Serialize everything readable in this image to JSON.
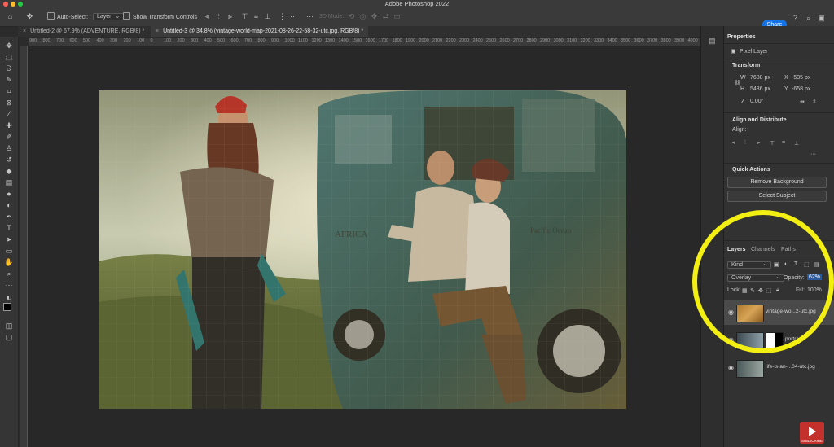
{
  "app": {
    "title": "Adobe Photoshop 2022"
  },
  "options_bar": {
    "auto_select_label": "Auto-Select:",
    "auto_select_value": "Layer",
    "show_transform_label": "Show Transform Controls",
    "mode_3d_label": "3D Mode:",
    "share_label": "Share"
  },
  "tabs": [
    {
      "label": "Untitled-2 @ 67.9% (ADVENTURE, RGB/8) *",
      "active": false
    },
    {
      "label": "Untitled-3 @ 34.8% (vintage-world-map-2021-08-26-22-58-32-utc.jpg, RGB/8) *",
      "active": true
    }
  ],
  "ruler_ticks": [
    "900",
    "800",
    "700",
    "600",
    "500",
    "400",
    "300",
    "200",
    "100",
    "0",
    "100",
    "200",
    "300",
    "400",
    "500",
    "600",
    "700",
    "800",
    "900",
    "1000",
    "1100",
    "1200",
    "1300",
    "1400",
    "1500",
    "1600",
    "1700",
    "1800",
    "1900",
    "2000",
    "2100",
    "2200",
    "2300",
    "2400",
    "2500",
    "2600",
    "2700",
    "2800",
    "2900",
    "3000",
    "3100",
    "3200",
    "3300",
    "3400",
    "3500",
    "3600",
    "3700",
    "3800",
    "3900",
    "4000"
  ],
  "canvas": {
    "map_labels": [
      "AFRICA",
      "Pacific Ocean"
    ]
  },
  "properties": {
    "tab_label": "Properties",
    "layer_type": "Pixel Layer",
    "transform": {
      "title": "Transform",
      "w_label": "W",
      "w_value": "7688 px",
      "x_label": "X",
      "x_value": "-535 px",
      "h_label": "H",
      "h_value": "5436 px",
      "y_label": "Y",
      "y_value": "-658 px",
      "angle_value": "0.00°"
    },
    "align": {
      "title": "Align and Distribute",
      "align_label": "Align:"
    },
    "quick_actions": {
      "title": "Quick Actions",
      "remove_bg": "Remove Background",
      "select_subject": "Select Subject"
    }
  },
  "layers_panel": {
    "tabs": [
      "Layers",
      "Channels",
      "Paths"
    ],
    "kind_label": "Kind",
    "blend_mode": "Overlay",
    "opacity_label": "Opacity:",
    "opacity_value": "62%",
    "lock_label": "Lock:",
    "fill_label": "Fill:",
    "fill_value": "100%",
    "layers": [
      {
        "name": "vintage-wo...2-utc.jpg",
        "selected": true
      },
      {
        "name": "portra",
        "selected": false
      },
      {
        "name": "life-is-an-...04-utc.jpg",
        "selected": false
      }
    ]
  },
  "youtube_badge": {
    "label": "SUBSCRIBE"
  },
  "colors": {
    "accent_blue": "#1473e6",
    "highlight_circle": "#f4ef13",
    "panel_bg": "#323232"
  }
}
